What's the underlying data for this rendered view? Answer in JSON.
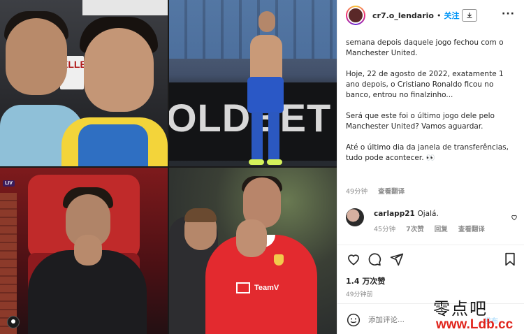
{
  "header": {
    "username": "cr7.o_lendario",
    "separator": "•",
    "follow_label": "关注",
    "download_icon": "download-icon",
    "more_icon": "more-options-icon",
    "more_glyph": "···"
  },
  "caption": {
    "para1": "semana depois daquele jogo fechou com o Manchester United.",
    "para2": "Hoje, 22 de agosto de 2022, exatamente 1 ano depois, o Cristiano Ronaldo ficou no banco, entrou no finalzinho...",
    "para3": "Será que este foi o último jogo dele pelo Manchester United? Vamos aguardar.",
    "para4": "Até o último dia da janela de transferências, tudo pode acontecer. 👀"
  },
  "caption_meta": {
    "time": "49分钟",
    "translate": "查看翻译"
  },
  "comment": {
    "user": "carlapp21",
    "text": "Ojalá.",
    "time": "45分钟",
    "likes": "7次赞",
    "reply": "回复",
    "translate": "查看翻译"
  },
  "actions": {
    "like_icon": "heart-icon",
    "comment_icon": "comment-icon",
    "share_icon": "share-icon",
    "save_icon": "bookmark-icon"
  },
  "post": {
    "likes": "1.4 万次赞",
    "time": "49分钟前"
  },
  "composer": {
    "placeholder": "添加评论...",
    "post_label": "发布"
  },
  "collage": {
    "board_text": "OLDBET",
    "sign_text": "ELLE",
    "badge_text": "LIV",
    "sponsor_text": "TeamV"
  },
  "watermark": {
    "line1": "零点吧",
    "line2": "www.Ldb.cc"
  }
}
